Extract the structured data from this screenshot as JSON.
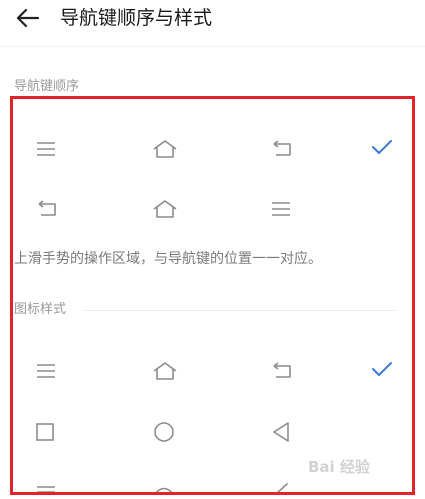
{
  "header": {
    "title": "导航键顺序与样式"
  },
  "order_section": {
    "label": "导航键顺序",
    "options": [
      {
        "icons": [
          "menu-icon",
          "home-icon",
          "back-icon"
        ],
        "selected": true
      },
      {
        "icons": [
          "back-icon",
          "home-icon",
          "menu-icon"
        ],
        "selected": false
      }
    ],
    "description": "上滑手势的操作区域，与导航键的位置一一对应。"
  },
  "style_section": {
    "label": "图标样式",
    "options": [
      {
        "icons": [
          "menu-icon",
          "home-icon",
          "back-icon"
        ],
        "selected": true
      },
      {
        "icons": [
          "square-icon",
          "circle-icon",
          "triangle-back-icon"
        ],
        "selected": false
      },
      {
        "icons": [
          "line-menu-icon",
          "arc-home-icon",
          "chevron-back-icon"
        ],
        "selected": false
      }
    ]
  },
  "colors": {
    "accent": "#3a7bd5",
    "icon": "#8c8c8c",
    "highlight_box": "#e2232a"
  },
  "watermark": "Bai 经验"
}
